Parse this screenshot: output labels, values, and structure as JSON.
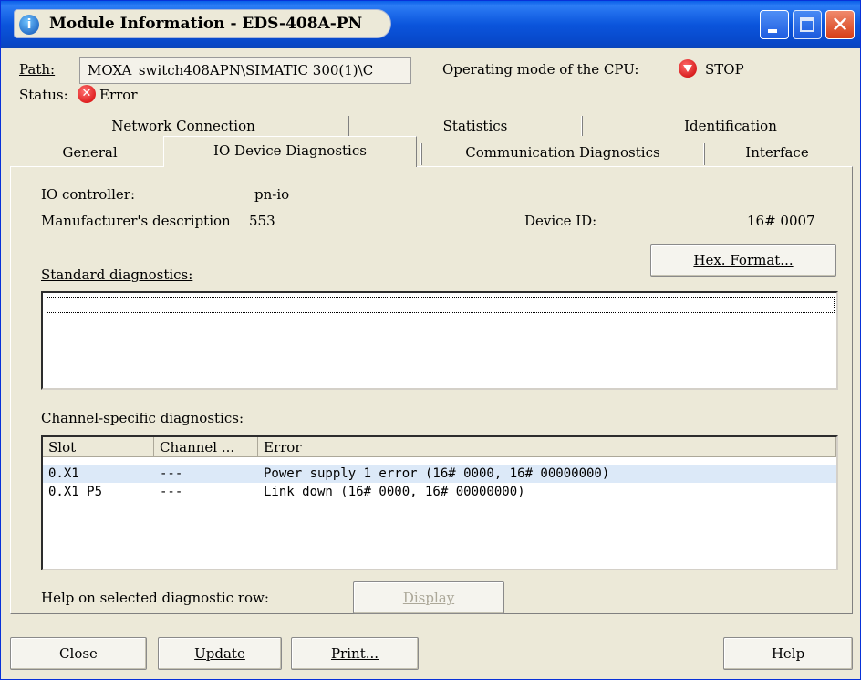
{
  "window": {
    "title": "Module Information - EDS-408A-PN",
    "icon": "info-icon"
  },
  "info": {
    "path_label": "Path:",
    "path_value": "MOXA_switch408APN\\SIMATIC 300(1)\\C",
    "cpu_mode_label": "Operating mode of the  CPU:",
    "cpu_mode_value": "STOP",
    "status_label": "Status:",
    "status_value": "Error"
  },
  "tabs": {
    "row1": [
      "Network Connection",
      "Statistics",
      "Identification"
    ],
    "row2": [
      "General",
      "IO Device Diagnostics",
      "Communication Diagnostics",
      "Interface"
    ],
    "active": "IO Device Diagnostics"
  },
  "details": {
    "io_controller_label": "IO controller:",
    "io_controller_value": "pn-io",
    "manufacturer_label": "Manufacturer's description",
    "manufacturer_value": "553",
    "device_id_label": "Device ID:",
    "device_id_value": "16# 0007",
    "hex_button": "Hex. Format..."
  },
  "standard_diag": {
    "label": "Standard diagnostics:"
  },
  "channel_diag": {
    "label": "Channel-specific diagnostics:",
    "columns": [
      "Slot",
      "Channel ...",
      "Error"
    ],
    "rows": [
      {
        "slot": "0.X1",
        "channel": "---",
        "error": "Power supply 1 error  (16# 0000, 16# 00000000)"
      },
      {
        "slot": "0.X1 P5",
        "channel": "---",
        "error": "Link down  (16# 0000, 16# 00000000)"
      }
    ]
  },
  "help_row": {
    "label": "Help on selected diagnostic row:",
    "display_button": "Display"
  },
  "footer": {
    "close": "Close",
    "update": "Update",
    "print": "Print...",
    "help": "Help"
  },
  "colors": {
    "titlebar": "#0b55dc",
    "window_bg": "#ece9d8",
    "selected_row": "#dce9f8",
    "error_red": "#d20000"
  }
}
